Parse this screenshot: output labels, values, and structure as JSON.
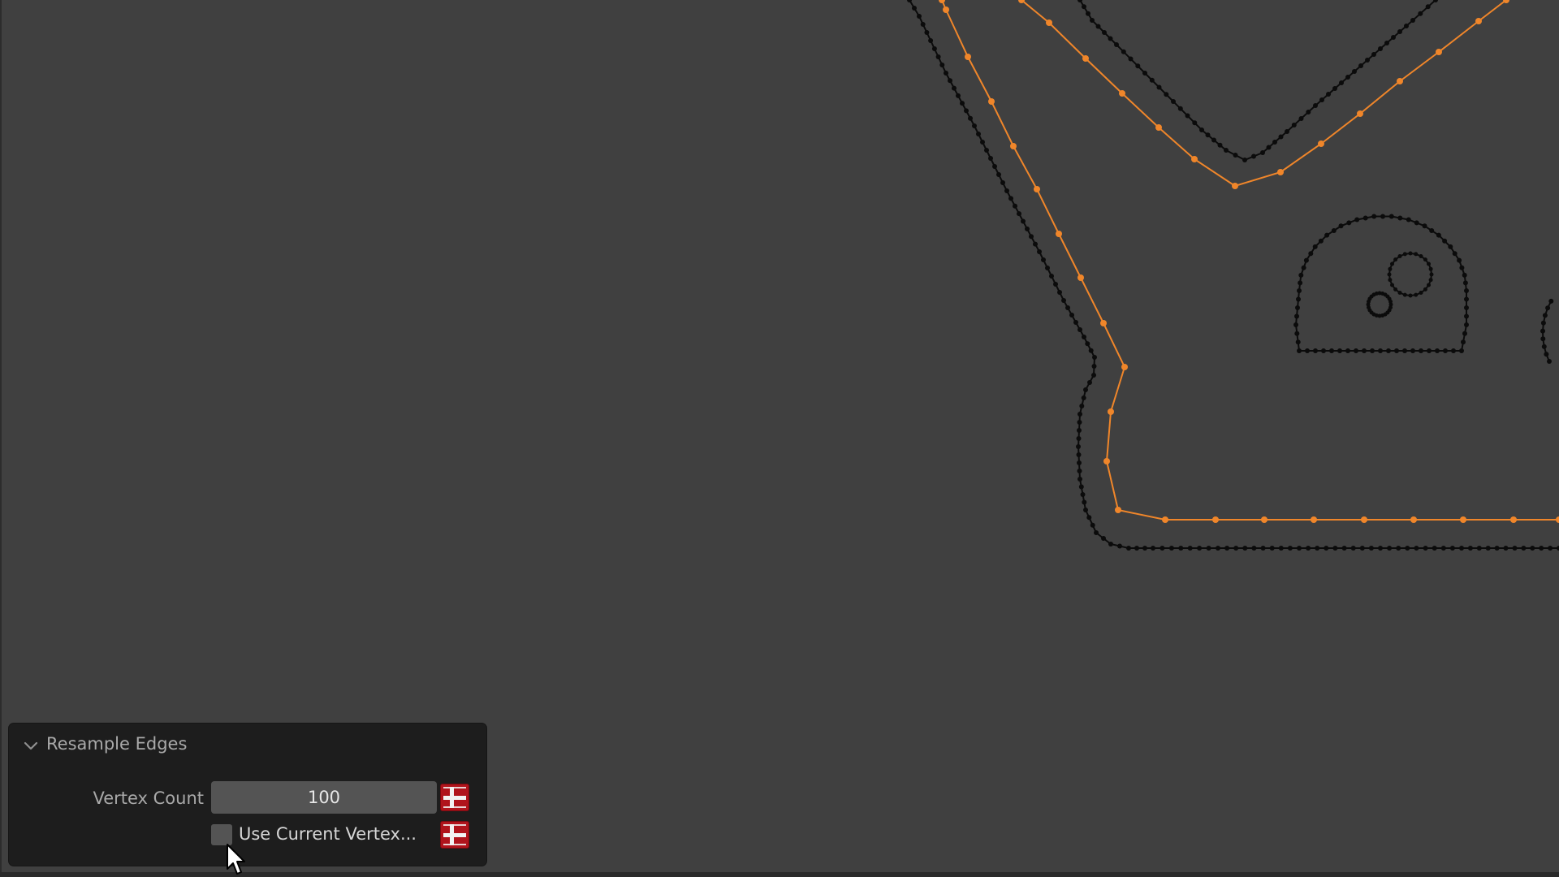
{
  "operator_panel": {
    "title": "Resample Edges",
    "expanded": true,
    "vertex_count": {
      "label": "Vertex Count",
      "value": "100"
    },
    "use_current_vertex": {
      "label": "Use Current Vertex...",
      "checked": false
    }
  },
  "colors": {
    "viewport_bg": "#404040",
    "selected_edge": "#f0862a",
    "unselected_edge": "#0a0a0a",
    "panel_bg": "#1d1d1d",
    "flag_red": "#b0141c"
  },
  "icons": {
    "collapse": "chevron-down-icon",
    "keyframe": "dutch-flag-icon",
    "pointer": "mouse-cursor-icon"
  }
}
